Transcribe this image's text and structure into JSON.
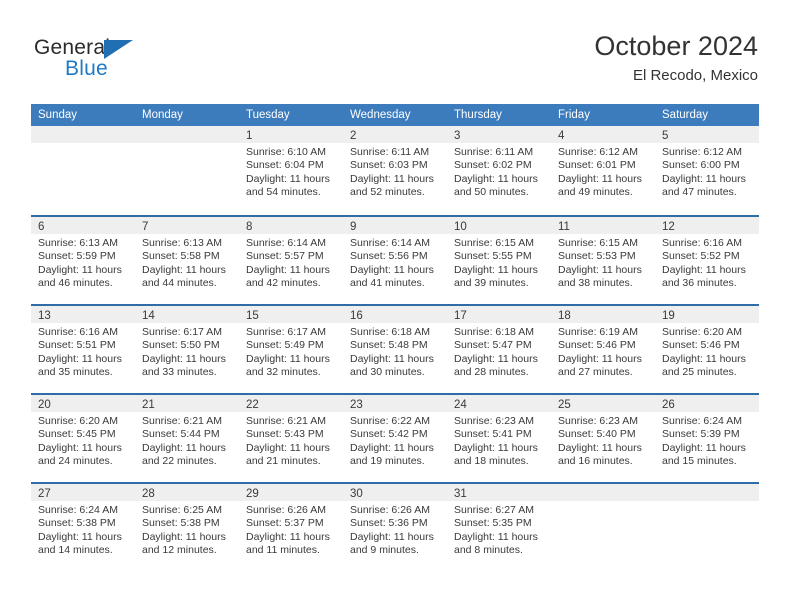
{
  "brand": {
    "word_one": "General",
    "word_two": "Blue"
  },
  "header": {
    "title": "October 2024",
    "subtitle": "El Recodo, Mexico"
  },
  "colors": {
    "header_blue": "#3c7cbd",
    "row_divider_blue": "#2f6ca8",
    "day_band_gray": "#efefef",
    "brand_blue": "#1f7ac4",
    "text": "#3a3a3a"
  },
  "weekdays": [
    "Sunday",
    "Monday",
    "Tuesday",
    "Wednesday",
    "Thursday",
    "Friday",
    "Saturday"
  ],
  "weeks": [
    [
      {
        "day": "",
        "sunrise": "",
        "sunset": "",
        "daylight_line1": "",
        "daylight_line2": ""
      },
      {
        "day": "",
        "sunrise": "",
        "sunset": "",
        "daylight_line1": "",
        "daylight_line2": ""
      },
      {
        "day": "1",
        "sunrise": "Sunrise: 6:10 AM",
        "sunset": "Sunset: 6:04 PM",
        "daylight_line1": "Daylight: 11 hours",
        "daylight_line2": "and 54 minutes."
      },
      {
        "day": "2",
        "sunrise": "Sunrise: 6:11 AM",
        "sunset": "Sunset: 6:03 PM",
        "daylight_line1": "Daylight: 11 hours",
        "daylight_line2": "and 52 minutes."
      },
      {
        "day": "3",
        "sunrise": "Sunrise: 6:11 AM",
        "sunset": "Sunset: 6:02 PM",
        "daylight_line1": "Daylight: 11 hours",
        "daylight_line2": "and 50 minutes."
      },
      {
        "day": "4",
        "sunrise": "Sunrise: 6:12 AM",
        "sunset": "Sunset: 6:01 PM",
        "daylight_line1": "Daylight: 11 hours",
        "daylight_line2": "and 49 minutes."
      },
      {
        "day": "5",
        "sunrise": "Sunrise: 6:12 AM",
        "sunset": "Sunset: 6:00 PM",
        "daylight_line1": "Daylight: 11 hours",
        "daylight_line2": "and 47 minutes."
      }
    ],
    [
      {
        "day": "6",
        "sunrise": "Sunrise: 6:13 AM",
        "sunset": "Sunset: 5:59 PM",
        "daylight_line1": "Daylight: 11 hours",
        "daylight_line2": "and 46 minutes."
      },
      {
        "day": "7",
        "sunrise": "Sunrise: 6:13 AM",
        "sunset": "Sunset: 5:58 PM",
        "daylight_line1": "Daylight: 11 hours",
        "daylight_line2": "and 44 minutes."
      },
      {
        "day": "8",
        "sunrise": "Sunrise: 6:14 AM",
        "sunset": "Sunset: 5:57 PM",
        "daylight_line1": "Daylight: 11 hours",
        "daylight_line2": "and 42 minutes."
      },
      {
        "day": "9",
        "sunrise": "Sunrise: 6:14 AM",
        "sunset": "Sunset: 5:56 PM",
        "daylight_line1": "Daylight: 11 hours",
        "daylight_line2": "and 41 minutes."
      },
      {
        "day": "10",
        "sunrise": "Sunrise: 6:15 AM",
        "sunset": "Sunset: 5:55 PM",
        "daylight_line1": "Daylight: 11 hours",
        "daylight_line2": "and 39 minutes."
      },
      {
        "day": "11",
        "sunrise": "Sunrise: 6:15 AM",
        "sunset": "Sunset: 5:53 PM",
        "daylight_line1": "Daylight: 11 hours",
        "daylight_line2": "and 38 minutes."
      },
      {
        "day": "12",
        "sunrise": "Sunrise: 6:16 AM",
        "sunset": "Sunset: 5:52 PM",
        "daylight_line1": "Daylight: 11 hours",
        "daylight_line2": "and 36 minutes."
      }
    ],
    [
      {
        "day": "13",
        "sunrise": "Sunrise: 6:16 AM",
        "sunset": "Sunset: 5:51 PM",
        "daylight_line1": "Daylight: 11 hours",
        "daylight_line2": "and 35 minutes."
      },
      {
        "day": "14",
        "sunrise": "Sunrise: 6:17 AM",
        "sunset": "Sunset: 5:50 PM",
        "daylight_line1": "Daylight: 11 hours",
        "daylight_line2": "and 33 minutes."
      },
      {
        "day": "15",
        "sunrise": "Sunrise: 6:17 AM",
        "sunset": "Sunset: 5:49 PM",
        "daylight_line1": "Daylight: 11 hours",
        "daylight_line2": "and 32 minutes."
      },
      {
        "day": "16",
        "sunrise": "Sunrise: 6:18 AM",
        "sunset": "Sunset: 5:48 PM",
        "daylight_line1": "Daylight: 11 hours",
        "daylight_line2": "and 30 minutes."
      },
      {
        "day": "17",
        "sunrise": "Sunrise: 6:18 AM",
        "sunset": "Sunset: 5:47 PM",
        "daylight_line1": "Daylight: 11 hours",
        "daylight_line2": "and 28 minutes."
      },
      {
        "day": "18",
        "sunrise": "Sunrise: 6:19 AM",
        "sunset": "Sunset: 5:46 PM",
        "daylight_line1": "Daylight: 11 hours",
        "daylight_line2": "and 27 minutes."
      },
      {
        "day": "19",
        "sunrise": "Sunrise: 6:20 AM",
        "sunset": "Sunset: 5:46 PM",
        "daylight_line1": "Daylight: 11 hours",
        "daylight_line2": "and 25 minutes."
      }
    ],
    [
      {
        "day": "20",
        "sunrise": "Sunrise: 6:20 AM",
        "sunset": "Sunset: 5:45 PM",
        "daylight_line1": "Daylight: 11 hours",
        "daylight_line2": "and 24 minutes."
      },
      {
        "day": "21",
        "sunrise": "Sunrise: 6:21 AM",
        "sunset": "Sunset: 5:44 PM",
        "daylight_line1": "Daylight: 11 hours",
        "daylight_line2": "and 22 minutes."
      },
      {
        "day": "22",
        "sunrise": "Sunrise: 6:21 AM",
        "sunset": "Sunset: 5:43 PM",
        "daylight_line1": "Daylight: 11 hours",
        "daylight_line2": "and 21 minutes."
      },
      {
        "day": "23",
        "sunrise": "Sunrise: 6:22 AM",
        "sunset": "Sunset: 5:42 PM",
        "daylight_line1": "Daylight: 11 hours",
        "daylight_line2": "and 19 minutes."
      },
      {
        "day": "24",
        "sunrise": "Sunrise: 6:23 AM",
        "sunset": "Sunset: 5:41 PM",
        "daylight_line1": "Daylight: 11 hours",
        "daylight_line2": "and 18 minutes."
      },
      {
        "day": "25",
        "sunrise": "Sunrise: 6:23 AM",
        "sunset": "Sunset: 5:40 PM",
        "daylight_line1": "Daylight: 11 hours",
        "daylight_line2": "and 16 minutes."
      },
      {
        "day": "26",
        "sunrise": "Sunrise: 6:24 AM",
        "sunset": "Sunset: 5:39 PM",
        "daylight_line1": "Daylight: 11 hours",
        "daylight_line2": "and 15 minutes."
      }
    ],
    [
      {
        "day": "27",
        "sunrise": "Sunrise: 6:24 AM",
        "sunset": "Sunset: 5:38 PM",
        "daylight_line1": "Daylight: 11 hours",
        "daylight_line2": "and 14 minutes."
      },
      {
        "day": "28",
        "sunrise": "Sunrise: 6:25 AM",
        "sunset": "Sunset: 5:38 PM",
        "daylight_line1": "Daylight: 11 hours",
        "daylight_line2": "and 12 minutes."
      },
      {
        "day": "29",
        "sunrise": "Sunrise: 6:26 AM",
        "sunset": "Sunset: 5:37 PM",
        "daylight_line1": "Daylight: 11 hours",
        "daylight_line2": "and 11 minutes."
      },
      {
        "day": "30",
        "sunrise": "Sunrise: 6:26 AM",
        "sunset": "Sunset: 5:36 PM",
        "daylight_line1": "Daylight: 11 hours",
        "daylight_line2": "and 9 minutes."
      },
      {
        "day": "31",
        "sunrise": "Sunrise: 6:27 AM",
        "sunset": "Sunset: 5:35 PM",
        "daylight_line1": "Daylight: 11 hours",
        "daylight_line2": "and 8 minutes."
      },
      {
        "day": "",
        "sunrise": "",
        "sunset": "",
        "daylight_line1": "",
        "daylight_line2": ""
      },
      {
        "day": "",
        "sunrise": "",
        "sunset": "",
        "daylight_line1": "",
        "daylight_line2": ""
      }
    ]
  ]
}
